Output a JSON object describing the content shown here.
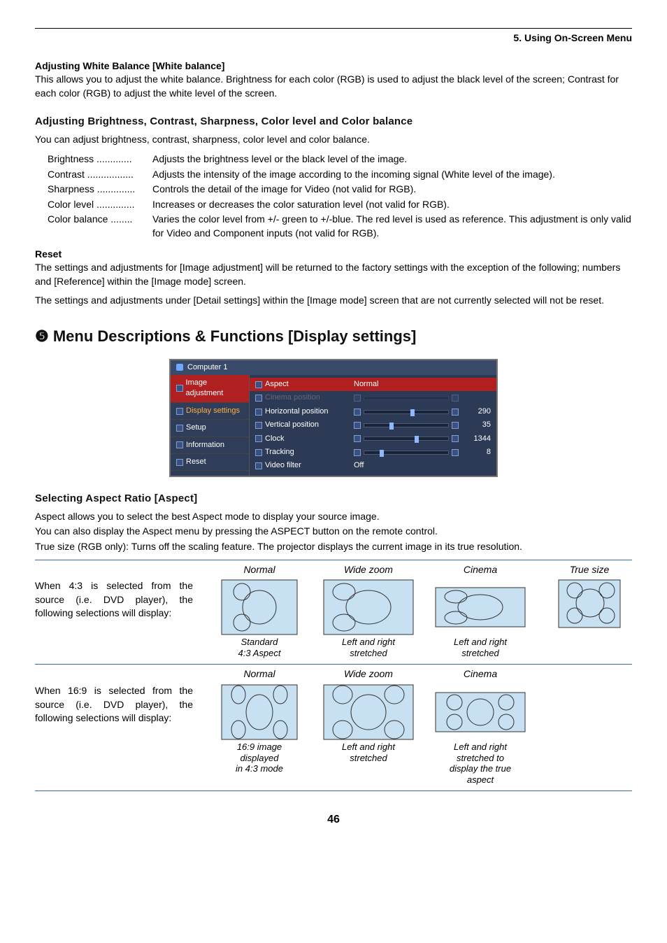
{
  "headerSection": "5. Using On-Screen Menu",
  "wb": {
    "heading": "Adjusting White Balance [White balance]",
    "body": "This allows you to adjust the white balance. Brightness for each color (RGB) is used to adjust the black level of the screen; Contrast for each color (RGB) to adjust the white level of the screen."
  },
  "bcs": {
    "heading": "Adjusting Brightness, Contrast, Sharpness, Color level and Color balance",
    "intro": "You can adjust brightness, contrast, sharpness, color level and color balance.",
    "defs": [
      {
        "label": "Brightness",
        "dots": ".............",
        "val": "Adjusts the brightness level or the black level of the image."
      },
      {
        "label": "Contrast",
        "dots": ".................",
        "val": "Adjusts the intensity of the image according to the incoming signal (White level of the image)."
      },
      {
        "label": "Sharpness",
        "dots": "..............",
        "val": "Controls the detail of the image for Video (not valid for RGB)."
      },
      {
        "label": "Color level",
        "dots": "..............",
        "val": "Increases or decreases the color saturation level (not valid for RGB)."
      },
      {
        "label": "Color balance",
        "dots": "........",
        "val": "Varies the color level from +/- green to +/-blue. The red level is used as reference. This adjustment is only valid for Video and Component inputs (not valid for RGB)."
      }
    ]
  },
  "reset": {
    "heading": "Reset",
    "p1": "The settings and adjustments for [Image adjustment] will be returned to the factory settings with the exception of the following; numbers and [Reference] within the [Image mode] screen.",
    "p2": "The settings and adjustments under [Detail settings] within the [Image mode] screen that are not currently selected will not be reset."
  },
  "h1": "❺ Menu Descriptions & Functions [Display settings]",
  "osd": {
    "title": "Computer 1",
    "left": [
      {
        "label": "Image adjustment",
        "cls": "sel"
      },
      {
        "label": "Display settings",
        "cls": "ds"
      },
      {
        "label": "Setup",
        "cls": ""
      },
      {
        "label": "Information",
        "cls": ""
      },
      {
        "label": "Reset",
        "cls": ""
      }
    ],
    "right": [
      {
        "label": "Aspect",
        "val": "Normal",
        "num": "",
        "sel": true,
        "type": "text"
      },
      {
        "label": "Cinema position",
        "val": "",
        "num": "",
        "type": "disabled"
      },
      {
        "label": "Horizontal position",
        "val": "",
        "num": "290",
        "type": "slider",
        "pos": 55
      },
      {
        "label": "Vertical position",
        "val": "",
        "num": "35",
        "type": "slider",
        "pos": 30
      },
      {
        "label": "Clock",
        "val": "",
        "num": "1344",
        "type": "slider",
        "pos": 60
      },
      {
        "label": "Tracking",
        "val": "",
        "num": "8",
        "type": "slider",
        "pos": 18
      },
      {
        "label": "Video filter",
        "val": "Off",
        "num": "",
        "type": "text"
      }
    ]
  },
  "aspect": {
    "heading": "Selecting Aspect Ratio [Aspect]",
    "p1": "Aspect allows you to select the best Aspect mode to display your source image.",
    "p2": "You can also display the Aspect menu by pressing the ASPECT button on the remote control.",
    "p3": "True size (RGB only): Turns off the scaling feature. The projector displays the current image in its true resolution.",
    "cols43": [
      "Normal",
      "Wide zoom",
      "Cinema",
      "True size"
    ],
    "row43label": "When 4:3 is selected from the source (i.e. DVD player), the following selections will display:",
    "caps43": [
      "Standard\n4:3 Aspect",
      "Left and right\nstretched",
      "Left and right\nstretched",
      ""
    ],
    "cols169": [
      "Normal",
      "Wide zoom",
      "Cinema",
      ""
    ],
    "row169label": "When 16:9 is selected from the source (i.e. DVD player), the following selections will display:",
    "caps169": [
      "16:9 image displayed\nin 4:3 mode",
      "Left and right\nstretched",
      "Left and right stretched to\ndisplay the true aspect",
      ""
    ]
  },
  "pageNum": "46"
}
